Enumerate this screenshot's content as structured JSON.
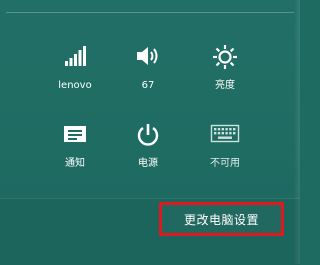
{
  "quick_settings": {
    "network": {
      "label": "lenovo",
      "icon": "wifi-signal-icon"
    },
    "volume": {
      "label": "67",
      "icon": "speaker-icon"
    },
    "brightness": {
      "label": "亮度",
      "icon": "sun-icon"
    },
    "notifications": {
      "label": "通知",
      "icon": "notification-icon"
    },
    "power": {
      "label": "电源",
      "icon": "power-icon"
    },
    "keyboard": {
      "label": "不可用",
      "icon": "keyboard-icon",
      "enabled": false
    }
  },
  "footer": {
    "settings_link": "更改电脑设置"
  },
  "colors": {
    "panel_background": "#1f6c63",
    "highlight_border": "#e0191f"
  }
}
